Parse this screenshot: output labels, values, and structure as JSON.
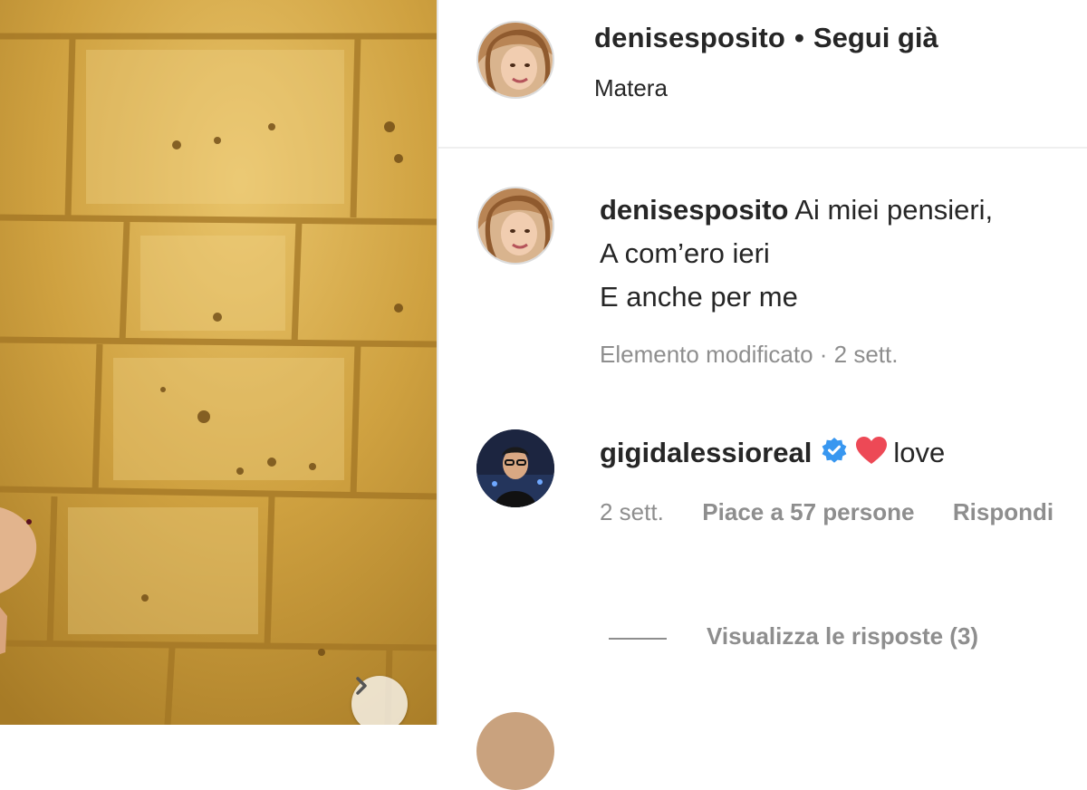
{
  "post": {
    "username": "denisesposito",
    "separator": "•",
    "follow_label": "Segui già",
    "location": "Matera"
  },
  "caption": {
    "username": "denisesposito",
    "lines": [
      "Ai miei pensieri,",
      "A com’ero ieri",
      "E anche per me"
    ],
    "meta": "Elemento modificato · 2 sett."
  },
  "comment": {
    "username": "gigidalessioreal",
    "text": "love",
    "time": "2 sett.",
    "likes": "Piace a 57 persone",
    "reply_label": "Rispondi",
    "view_replies": "Visualizza le risposte (3)"
  },
  "colors": {
    "text": "#262626",
    "secondary": "#8e8e8e",
    "verified": "#3897f0",
    "heart": "#ed4956",
    "wall": "#c79a3a"
  },
  "icons": {
    "carousel_next": "chevron-right-icon",
    "verified": "verified-badge-icon",
    "heart": "heart-icon"
  }
}
